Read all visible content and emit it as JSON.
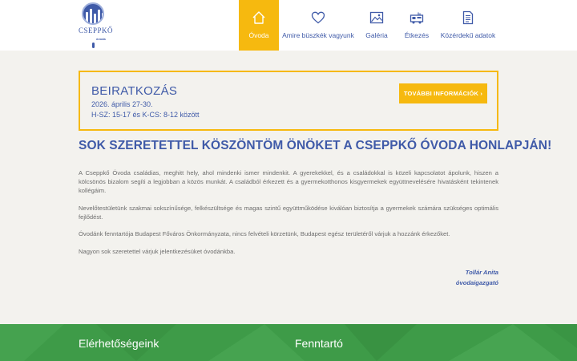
{
  "logo": {
    "text": "CSEPPKŐ",
    "sub": "óvoda"
  },
  "nav": [
    {
      "label": "Óvoda",
      "icon": "home-icon",
      "active": true
    },
    {
      "label": "Amire büszkék vagyunk",
      "icon": "heart-icon",
      "active": false
    },
    {
      "label": "Galéria",
      "icon": "image-icon",
      "active": false
    },
    {
      "label": "Étkezés",
      "icon": "food-truck-icon",
      "active": false
    },
    {
      "label": "Közérdekű adatok",
      "icon": "document-icon",
      "active": false
    }
  ],
  "banner": {
    "title": "BEIRATKOZÁS",
    "date": "2026. április 27-30.",
    "hours": "H-SZ: 15-17 és K-CS: 8-12 között",
    "button": "TOVÁBBI INFORMÁCIÓK  ›"
  },
  "page_title": "SOK SZERETETTEL KÖSZÖNTÖM ÖNÖKET A CSEPPKŐ ÓVODA HONLAPJÁN!",
  "paragraphs": [
    "A Cseppkő Óvoda családias, meghitt hely, ahol mindenki ismer mindenkit. A gyerekekkel, és a családokkal is közeli kapcsolatot ápolunk, hiszen a kölcsönös bizalom segíti a legjobban a közös munkát. A családból érkezett és a gyermekotthonos kisgyermekek együttnevelésére hivatásként tekintenek kollégáim.",
    "Nevelőtestületünk szakmai sokszínűsége, felkészültsége és magas szintű együttműködése kiválóan biztosítja a gyermekek számára szükséges optimális fejlődést.",
    "Óvodánk fenntartója Budapest Főváros Önkormányzata, nincs felvételi körzetünk, Budapest egész területéről várjuk a hozzánk érkezőket.",
    "Nagyon sok szeretettel várjuk jelentkezésüket óvodánkba."
  ],
  "signature": {
    "name": "Tollár Anita",
    "role": "óvodaigazgató"
  },
  "footer": {
    "col1": "Elérhetőségeink",
    "col2": "Fenntartó"
  },
  "colors": {
    "accent": "#f6b90f",
    "primary": "#3f5aa8",
    "footer": "#3e9b48",
    "background": "#f3f2ee"
  }
}
